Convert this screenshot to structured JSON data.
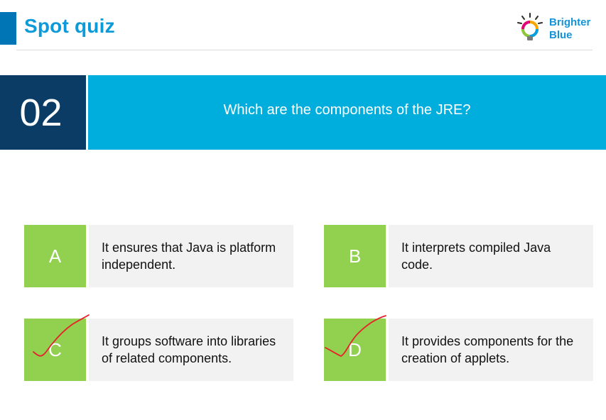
{
  "header": {
    "title": "Spot quiz",
    "logo": {
      "line1": "Brighter",
      "line2": "Blue",
      "icon": "lightbulb-logo-icon"
    }
  },
  "question": {
    "number": "02",
    "text": "Which are the components of the JRE?"
  },
  "answers": [
    {
      "letter": "A",
      "text": "It ensures that Java is platform independent.",
      "checked": false
    },
    {
      "letter": "B",
      "text": "It interprets compiled Java code.",
      "checked": false
    },
    {
      "letter": "C",
      "text": "It groups software into libraries of related components.",
      "checked": true
    },
    {
      "letter": "D",
      "text": "It provides components for the creation of applets.",
      "checked": true
    }
  ],
  "colors": {
    "title": "#0d9ad9",
    "accent_bar": "#0075b5",
    "number_bg": "#0a3c66",
    "question_bg": "#00aede",
    "letter_bg": "#92d050",
    "answer_bg": "#f2f2f2",
    "checkmark": "#e8202a"
  }
}
